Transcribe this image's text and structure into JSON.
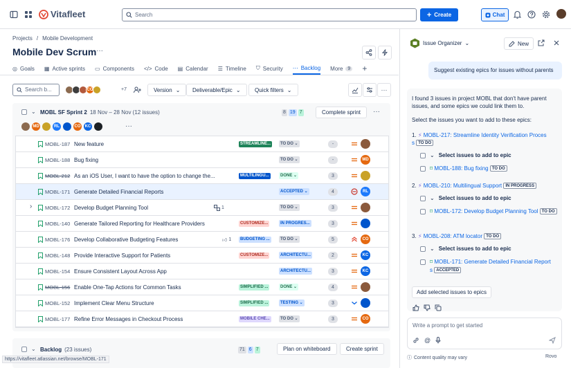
{
  "topbar": {
    "logo": "Vitafleet",
    "search_placeholder": "Search",
    "create_label": "Create",
    "chat_label": "Chat"
  },
  "header": {
    "breadcrumb": [
      "Projects",
      "Mobile Development"
    ],
    "title": "Mobile Dev Scrum",
    "more": "···"
  },
  "tabs": [
    {
      "label": "Goals"
    },
    {
      "label": "Active sprints"
    },
    {
      "label": "Components"
    },
    {
      "label": "Code"
    },
    {
      "label": "Calendar"
    },
    {
      "label": "Timeline"
    },
    {
      "label": "Security"
    },
    {
      "label": "Backlog",
      "active": true
    },
    {
      "label": "More",
      "badge": "9"
    }
  ],
  "filters": {
    "search_placeholder": "Search b...",
    "avatars": [
      {
        "initials": "",
        "color": "#8b6a4f"
      },
      {
        "initials": "",
        "color": "#3d3d3d"
      },
      {
        "initials": "",
        "color": "#b3593c"
      },
      {
        "initials": "CO",
        "color": "#e56910"
      },
      {
        "initials": "",
        "color": "#c9a227"
      }
    ],
    "avatar_more": "+7",
    "version": "Version",
    "deliverable": "Deliverable/Epic",
    "quick_filters": "Quick filters"
  },
  "sprint": {
    "name": "MOBL SF Sprint 2",
    "dates": "18 Nov – 28 Nov (12 issues)",
    "counts": [
      {
        "value": "8",
        "color": "#dfe1e6",
        "text": "#44546f"
      },
      {
        "value": "19",
        "color": "#cce0ff",
        "text": "#0055cc"
      },
      {
        "value": "7",
        "color": "#baf3db",
        "text": "#216e4e"
      }
    ],
    "complete_label": "Complete sprint",
    "assignee_avatars": [
      {
        "initials": "",
        "color": "#8b6a4f"
      },
      {
        "initials": "MD",
        "color": "#e56910"
      },
      {
        "initials": "",
        "color": "#c9a227"
      },
      {
        "initials": "RL",
        "color": "#1d7afc"
      },
      {
        "initials": "",
        "color": "#0055cc"
      },
      {
        "initials": "CO",
        "color": "#e56910"
      },
      {
        "initials": "KC",
        "color": "#0c66e4"
      },
      {
        "initials": "",
        "color": "#1d2125"
      }
    ],
    "issues": [
      {
        "key": "MOBL-187",
        "summary": "New feature",
        "epic": "STREAMLINE...",
        "epic_cls": "ep-green",
        "status": "TO DO ⌄",
        "status_cls": "st-todo",
        "points": "-",
        "prio": "medium",
        "avatar": "",
        "avatar_color": "#8b5a3c"
      },
      {
        "key": "MOBL-188",
        "summary": "Bug fixing",
        "epic": "",
        "epic_cls": "",
        "status": "TO DO ⌄",
        "status_cls": "st-todo",
        "points": "-",
        "prio": "medium",
        "avatar": "MD",
        "avatar_color": "#e56910"
      },
      {
        "key": "MOBL-212",
        "summary": "As an iOS User, I want to have the option to change the...",
        "epic": "MULTILINGU...",
        "epic_cls": "ep-navy",
        "status": "DONE ⌄",
        "status_cls": "st-done",
        "points": "3",
        "prio": "medium",
        "avatar": "",
        "avatar_color": "#c9a227",
        "strike": true
      },
      {
        "key": "MOBL-171",
        "summary": "Generate Detailed Financial Reports",
        "epic": "",
        "epic_cls": "",
        "status": "ACCEPTED ⌄",
        "status_cls": "st-acc",
        "points": "4",
        "prio": "blocker",
        "avatar": "RL",
        "avatar_color": "#1d7afc",
        "selected": true
      },
      {
        "key": "MOBL-172",
        "summary": "Develop Budget Planning Tool",
        "epic": "",
        "epic_cls": "",
        "status": "TO DO ⌄",
        "status_cls": "st-todo",
        "points": "3",
        "prio": "medium",
        "avatar": "",
        "avatar_color": "#8b5a3c",
        "expand": true,
        "extra": "1"
      },
      {
        "key": "MOBL-140",
        "summary": "Generate Tailored Reporting for Healthcare Providers",
        "epic": "CUSTOMIZE...",
        "epic_cls": "ep-pink",
        "status": "IN PROGRES...",
        "status_cls": "st-prog",
        "points": "3",
        "prio": "medium",
        "avatar": "",
        "avatar_color": "#0055cc"
      },
      {
        "key": "MOBL-176",
        "summary": "Develop Collaborative Budgeting Features",
        "epic": "BUDGETING ...",
        "epic_cls": "ep-blue",
        "status": "TO DO ⌄",
        "status_cls": "st-todo",
        "points": "5",
        "prio": "high",
        "avatar": "CO",
        "avatar_color": "#e56910",
        "extra2": "1"
      },
      {
        "key": "MOBL-148",
        "summary": "Provide Interactive Support for Patients",
        "epic": "CUSTOMIZE...",
        "epic_cls": "ep-pink",
        "status": "ARCHITECTU...",
        "status_cls": "st-prog",
        "points": "2",
        "prio": "medium",
        "avatar": "KC",
        "avatar_color": "#0c66e4"
      },
      {
        "key": "MOBL-154",
        "summary": "Ensure Consistent Layout Across App",
        "epic": "",
        "epic_cls": "",
        "status": "ARCHITECTU...",
        "status_cls": "st-prog",
        "points": "3",
        "prio": "medium",
        "avatar": "KC",
        "avatar_color": "#0c66e4"
      },
      {
        "key": "MOBL-156",
        "summary": "Enable One-Tap Actions for Common Tasks",
        "epic": "SIMPLIFIED ...",
        "epic_cls": "ep-lgreen",
        "status": "DONE ⌄",
        "status_cls": "st-done",
        "points": "4",
        "prio": "medium",
        "avatar": "",
        "avatar_color": "#8b5a3c",
        "strike": true
      },
      {
        "key": "MOBL-152",
        "summary": "Implement Clear Menu Structure",
        "epic": "SIMPLIFIED ...",
        "epic_cls": "ep-lgreen",
        "status": "TESTING ⌄",
        "status_cls": "st-test",
        "points": "3",
        "prio": "low",
        "avatar": "",
        "avatar_color": "#0055cc"
      },
      {
        "key": "MOBL-177",
        "summary": "Refine Error Messages in Checkout Process",
        "epic": "MOBILE CHE...",
        "epic_cls": "ep-purple",
        "status": "TO DO ⌄",
        "status_cls": "st-todo",
        "points": "3",
        "prio": "medium",
        "avatar": "CO",
        "avatar_color": "#e56910"
      }
    ]
  },
  "backlog": {
    "name": "Backlog",
    "count": "(23 issues)",
    "counts": [
      {
        "value": "71",
        "color": "#dfe1e6",
        "text": "#44546f"
      },
      {
        "value": "6",
        "color": "#cce0ff",
        "text": "#0055cc"
      },
      {
        "value": "7",
        "color": "#baf3db",
        "text": "#216e4e"
      }
    ],
    "whiteboard_label": "Plan on whiteboard",
    "create_sprint_label": "Create sprint"
  },
  "status_url": "https://vitafleet.atlassian.net/browse/MOBL-171",
  "panel": {
    "agent_name": "Issue Organizer",
    "new_label": "New",
    "user_message": "Suggest existing epics for issues without parents",
    "intro": "I found 3 issues in project MOBL that don't have parent issues, and some epics we could link them to.",
    "instruction": "Select the issues you want to add to these epics:",
    "groups": [
      {
        "num": "1.",
        "epic": "MOBL-217: Streamline Identity Verification Proces",
        "epic_tail": "s",
        "lozenge": "TO DO",
        "select_label": "Select issues to add to epic",
        "issue": "MOBL-188: Bug fixing",
        "issue_lozenge": "TO DO"
      },
      {
        "num": "2.",
        "epic": "MOBL-210: Multilingual Support",
        "epic_tail": "",
        "lozenge": "IN PROGRESS",
        "select_label": "Select issues to add to epic",
        "issue": "MOBL-172: Develop Budget Planning Tool",
        "issue_lozenge": "TO DO"
      },
      {
        "num": "3.",
        "epic": "MOBL-208: ATM locator",
        "epic_tail": "",
        "lozenge": "TO DO",
        "select_label": "Select issues to add to epic",
        "issue": "MOBL-171: Generate Detailed Financial Report",
        "issue_tail": "s",
        "issue_lozenge": "ACCEPTED"
      }
    ],
    "add_button": "Add selected issues to epics",
    "prompt_placeholder": "Write a prompt to get started",
    "footer_note": "Content quality may vary",
    "footer_brand": "Rovo"
  }
}
